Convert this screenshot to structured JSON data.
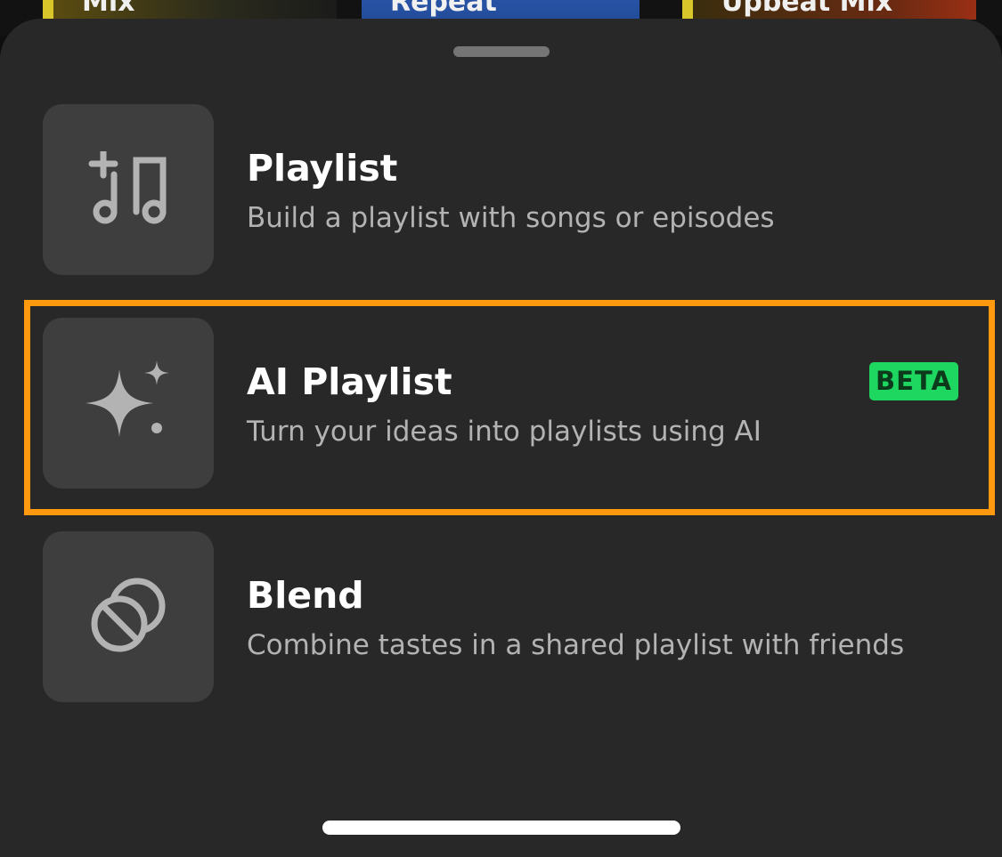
{
  "background_cards": [
    {
      "label": "Mix"
    },
    {
      "label": "Repeat"
    },
    {
      "label": "Upbeat Mix"
    }
  ],
  "options": [
    {
      "icon": "playlist-add-icon",
      "title": "Playlist",
      "description": "Build a playlist with songs or episodes"
    },
    {
      "icon": "sparkle-icon",
      "title": "AI Playlist",
      "description": "Turn your ideas into playlists using AI",
      "badge": "BETA"
    },
    {
      "icon": "blend-icon",
      "title": "Blend",
      "description": "Combine tastes in a shared playlist with friends"
    }
  ],
  "colors": {
    "sheet": "#282828",
    "tile": "#3e3e3e",
    "badge": "#1ed760",
    "highlight": "#ff9a0e"
  }
}
